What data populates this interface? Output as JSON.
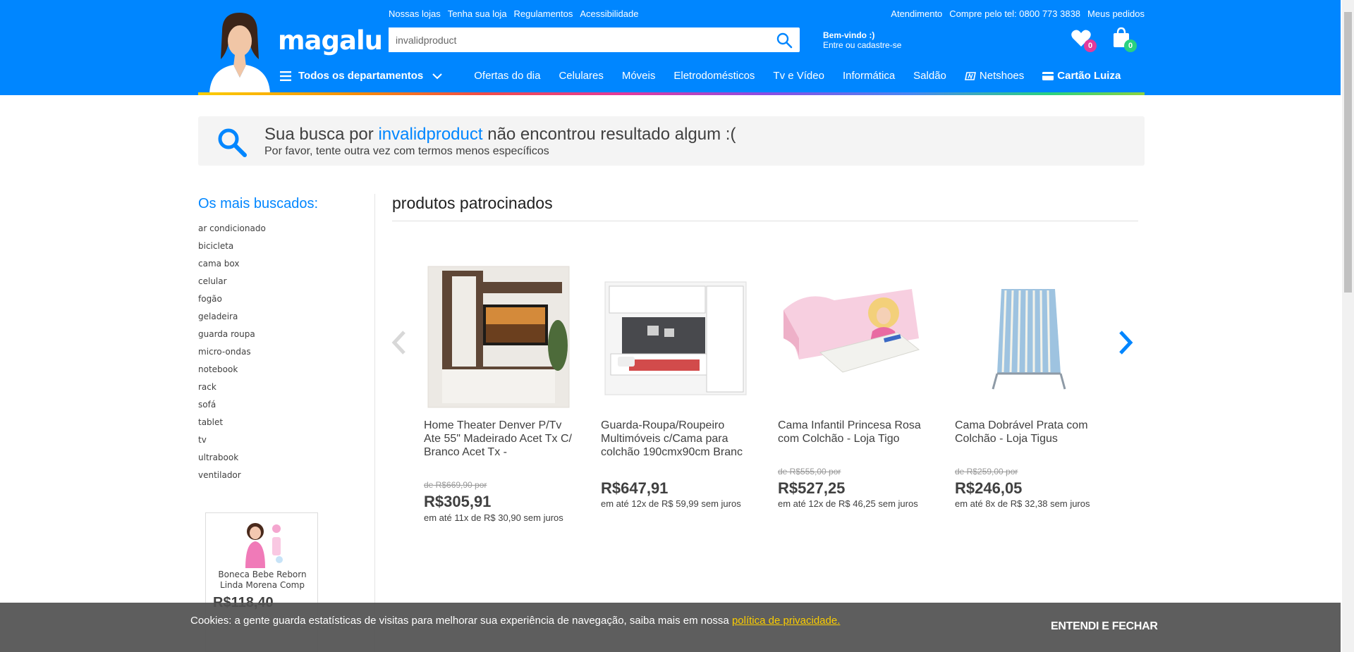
{
  "header": {
    "logo": "magalu",
    "top_links_left": [
      "Nossas lojas",
      "Tenha sua loja",
      "Regulamentos",
      "Acessibilidade"
    ],
    "top_links_right": [
      "Atendimento",
      "Compre pelo tel: 0800 773 3838",
      "Meus pedidos"
    ],
    "search": {
      "value": "invalidproduct",
      "placeholder": ""
    },
    "welcome": {
      "line1": "Bem-vindo :)",
      "line2": "Entre ou cadastre-se"
    },
    "favorites_count": "0",
    "cart_count": "0",
    "nav": {
      "departments": "Todos os departamentos",
      "items": [
        "Ofertas do dia",
        "Celulares",
        "Móveis",
        "Eletrodomésticos",
        "Tv e Vídeo",
        "Informática",
        "Saldão"
      ],
      "netshoes": "Netshoes",
      "cartao": "Cartão Luiza"
    },
    "colors": {
      "header_bg": "#0086ff",
      "fav_badge": "#e43a9b",
      "cart_badge": "#2ad180"
    }
  },
  "noresult": {
    "prefix": "Sua busca por",
    "term": "invalidproduct",
    "suffix": "não encontrou resultado algum :(",
    "hint": "Por favor, tente outra vez com termos menos específicos"
  },
  "sidebar": {
    "title": "Os mais buscados:",
    "items": [
      "ar condicionado",
      "bicicleta",
      "cama box",
      "celular",
      "fogão",
      "geladeira",
      "guarda roupa",
      "micro-ondas",
      "notebook",
      "rack",
      "sofá",
      "tablet",
      "tv",
      "ultrabook",
      "ventilador"
    ],
    "ad": {
      "name": "Boneca Bebe Reborn Linda Morena Comp",
      "price": "R$118,40"
    }
  },
  "sponsored": {
    "title": "produtos patrocinados",
    "products": [
      {
        "name": "Home Theater Denver P/Tv Ate 55\" Madeirado Acet Tx C/ Branco Acet Tx -",
        "old": "de R$669,90 por",
        "price": "R$305,91",
        "installments": "em até 11x de R$ 30,90 sem juros"
      },
      {
        "name": "Guarda-Roupa/Roupeiro Multimóveis c/Cama para colchão 190cmx90cm Branc",
        "old": "",
        "price": "R$647,91",
        "installments": "em até 12x de R$ 59,99 sem juros"
      },
      {
        "name": "Cama Infantil Princesa Rosa com Colchão - Loja Tigo",
        "old": "de R$555,00 por",
        "price": "R$527,25",
        "installments": "em até 12x de R$ 46,25 sem juros"
      },
      {
        "name": "Cama Dobrável Prata com Colchão - Loja Tigus",
        "old": "de R$259,00 por",
        "price": "R$246,05",
        "installments": "em até 8x de R$ 32,38 sem juros"
      }
    ]
  },
  "cookie": {
    "text": "Cookies: a gente guarda estatísticas de visitas para melhorar sua experiência de navegação, saiba mais em nossa",
    "link": "política de privacidade.",
    "button": "ENTENDI E FECHAR"
  }
}
